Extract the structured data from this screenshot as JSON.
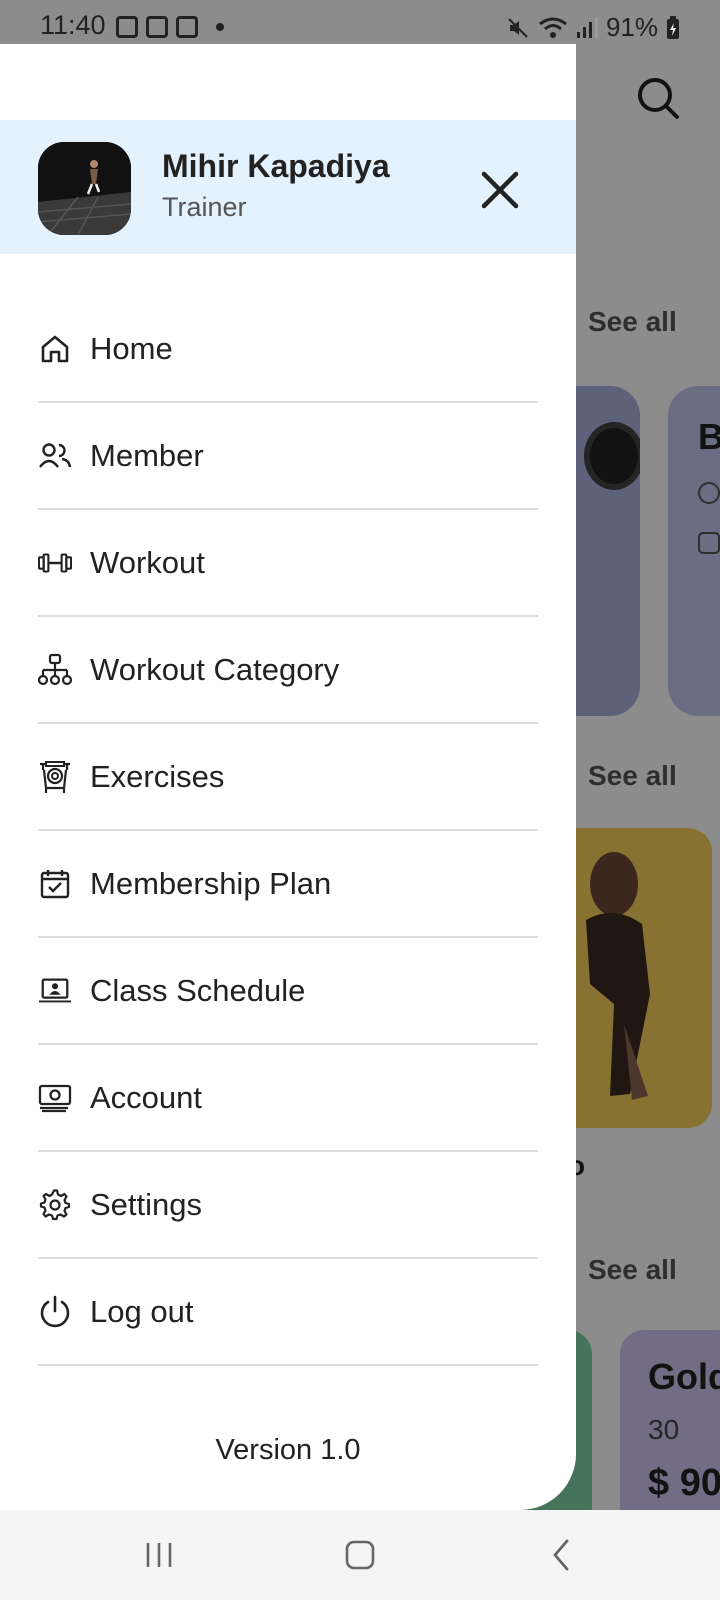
{
  "status_bar": {
    "time": "11:40",
    "battery": "91%"
  },
  "background": {
    "see_all_1": "See all",
    "see_all_2": "See all",
    "see_all_3": "See all",
    "card2_title": "B",
    "card3_text": "o",
    "card5_title": "Gold",
    "card5_sub": "30",
    "card5_price": "$ 90"
  },
  "drawer": {
    "profile": {
      "name": "Mihir Kapadiya",
      "role": "Trainer"
    },
    "menu": [
      {
        "label": "Home",
        "icon": "home-icon"
      },
      {
        "label": "Member",
        "icon": "members-icon"
      },
      {
        "label": "Workout",
        "icon": "dumbbell-icon"
      },
      {
        "label": "Workout Category",
        "icon": "hierarchy-icon"
      },
      {
        "label": "Exercises",
        "icon": "weight-machine-icon"
      },
      {
        "label": "Membership Plan",
        "icon": "calendar-check-icon"
      },
      {
        "label": "Class Schedule",
        "icon": "laptop-user-icon"
      },
      {
        "label": "Account",
        "icon": "cash-icon"
      },
      {
        "label": "Settings",
        "icon": "gear-icon"
      },
      {
        "label": "Log out",
        "icon": "power-icon"
      }
    ],
    "version": "Version 1.0"
  },
  "colors": {
    "profile_bg": "#e3f2fd",
    "scrim": "rgba(0,0,0,0.45)",
    "divider": "#dddddd"
  }
}
